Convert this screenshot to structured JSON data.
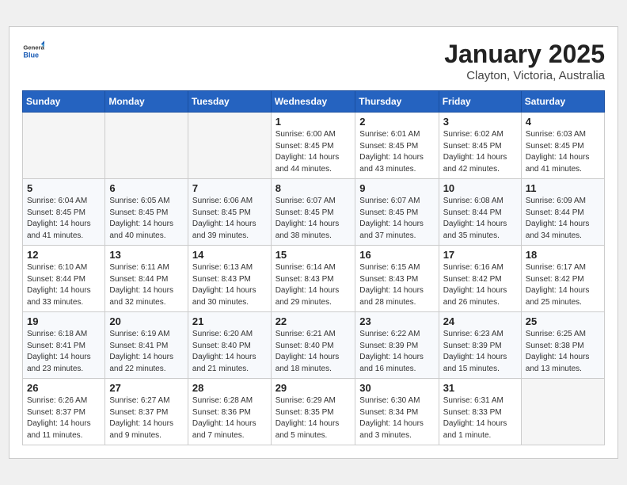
{
  "header": {
    "logo_general": "General",
    "logo_blue": "Blue",
    "title": "January 2025",
    "subtitle": "Clayton, Victoria, Australia"
  },
  "weekdays": [
    "Sunday",
    "Monday",
    "Tuesday",
    "Wednesday",
    "Thursday",
    "Friday",
    "Saturday"
  ],
  "weeks": [
    [
      {
        "day": "",
        "info": ""
      },
      {
        "day": "",
        "info": ""
      },
      {
        "day": "",
        "info": ""
      },
      {
        "day": "1",
        "info": "Sunrise: 6:00 AM\nSunset: 8:45 PM\nDaylight: 14 hours\nand 44 minutes."
      },
      {
        "day": "2",
        "info": "Sunrise: 6:01 AM\nSunset: 8:45 PM\nDaylight: 14 hours\nand 43 minutes."
      },
      {
        "day": "3",
        "info": "Sunrise: 6:02 AM\nSunset: 8:45 PM\nDaylight: 14 hours\nand 42 minutes."
      },
      {
        "day": "4",
        "info": "Sunrise: 6:03 AM\nSunset: 8:45 PM\nDaylight: 14 hours\nand 41 minutes."
      }
    ],
    [
      {
        "day": "5",
        "info": "Sunrise: 6:04 AM\nSunset: 8:45 PM\nDaylight: 14 hours\nand 41 minutes."
      },
      {
        "day": "6",
        "info": "Sunrise: 6:05 AM\nSunset: 8:45 PM\nDaylight: 14 hours\nand 40 minutes."
      },
      {
        "day": "7",
        "info": "Sunrise: 6:06 AM\nSunset: 8:45 PM\nDaylight: 14 hours\nand 39 minutes."
      },
      {
        "day": "8",
        "info": "Sunrise: 6:07 AM\nSunset: 8:45 PM\nDaylight: 14 hours\nand 38 minutes."
      },
      {
        "day": "9",
        "info": "Sunrise: 6:07 AM\nSunset: 8:45 PM\nDaylight: 14 hours\nand 37 minutes."
      },
      {
        "day": "10",
        "info": "Sunrise: 6:08 AM\nSunset: 8:44 PM\nDaylight: 14 hours\nand 35 minutes."
      },
      {
        "day": "11",
        "info": "Sunrise: 6:09 AM\nSunset: 8:44 PM\nDaylight: 14 hours\nand 34 minutes."
      }
    ],
    [
      {
        "day": "12",
        "info": "Sunrise: 6:10 AM\nSunset: 8:44 PM\nDaylight: 14 hours\nand 33 minutes."
      },
      {
        "day": "13",
        "info": "Sunrise: 6:11 AM\nSunset: 8:44 PM\nDaylight: 14 hours\nand 32 minutes."
      },
      {
        "day": "14",
        "info": "Sunrise: 6:13 AM\nSunset: 8:43 PM\nDaylight: 14 hours\nand 30 minutes."
      },
      {
        "day": "15",
        "info": "Sunrise: 6:14 AM\nSunset: 8:43 PM\nDaylight: 14 hours\nand 29 minutes."
      },
      {
        "day": "16",
        "info": "Sunrise: 6:15 AM\nSunset: 8:43 PM\nDaylight: 14 hours\nand 28 minutes."
      },
      {
        "day": "17",
        "info": "Sunrise: 6:16 AM\nSunset: 8:42 PM\nDaylight: 14 hours\nand 26 minutes."
      },
      {
        "day": "18",
        "info": "Sunrise: 6:17 AM\nSunset: 8:42 PM\nDaylight: 14 hours\nand 25 minutes."
      }
    ],
    [
      {
        "day": "19",
        "info": "Sunrise: 6:18 AM\nSunset: 8:41 PM\nDaylight: 14 hours\nand 23 minutes."
      },
      {
        "day": "20",
        "info": "Sunrise: 6:19 AM\nSunset: 8:41 PM\nDaylight: 14 hours\nand 22 minutes."
      },
      {
        "day": "21",
        "info": "Sunrise: 6:20 AM\nSunset: 8:40 PM\nDaylight: 14 hours\nand 21 minutes."
      },
      {
        "day": "22",
        "info": "Sunrise: 6:21 AM\nSunset: 8:40 PM\nDaylight: 14 hours\nand 18 minutes."
      },
      {
        "day": "23",
        "info": "Sunrise: 6:22 AM\nSunset: 8:39 PM\nDaylight: 14 hours\nand 16 minutes."
      },
      {
        "day": "24",
        "info": "Sunrise: 6:23 AM\nSunset: 8:39 PM\nDaylight: 14 hours\nand 15 minutes."
      },
      {
        "day": "25",
        "info": "Sunrise: 6:25 AM\nSunset: 8:38 PM\nDaylight: 14 hours\nand 13 minutes."
      }
    ],
    [
      {
        "day": "26",
        "info": "Sunrise: 6:26 AM\nSunset: 8:37 PM\nDaylight: 14 hours\nand 11 minutes."
      },
      {
        "day": "27",
        "info": "Sunrise: 6:27 AM\nSunset: 8:37 PM\nDaylight: 14 hours\nand 9 minutes."
      },
      {
        "day": "28",
        "info": "Sunrise: 6:28 AM\nSunset: 8:36 PM\nDaylight: 14 hours\nand 7 minutes."
      },
      {
        "day": "29",
        "info": "Sunrise: 6:29 AM\nSunset: 8:35 PM\nDaylight: 14 hours\nand 5 minutes."
      },
      {
        "day": "30",
        "info": "Sunrise: 6:30 AM\nSunset: 8:34 PM\nDaylight: 14 hours\nand 3 minutes."
      },
      {
        "day": "31",
        "info": "Sunrise: 6:31 AM\nSunset: 8:33 PM\nDaylight: 14 hours\nand 1 minute."
      },
      {
        "day": "",
        "info": ""
      }
    ]
  ]
}
